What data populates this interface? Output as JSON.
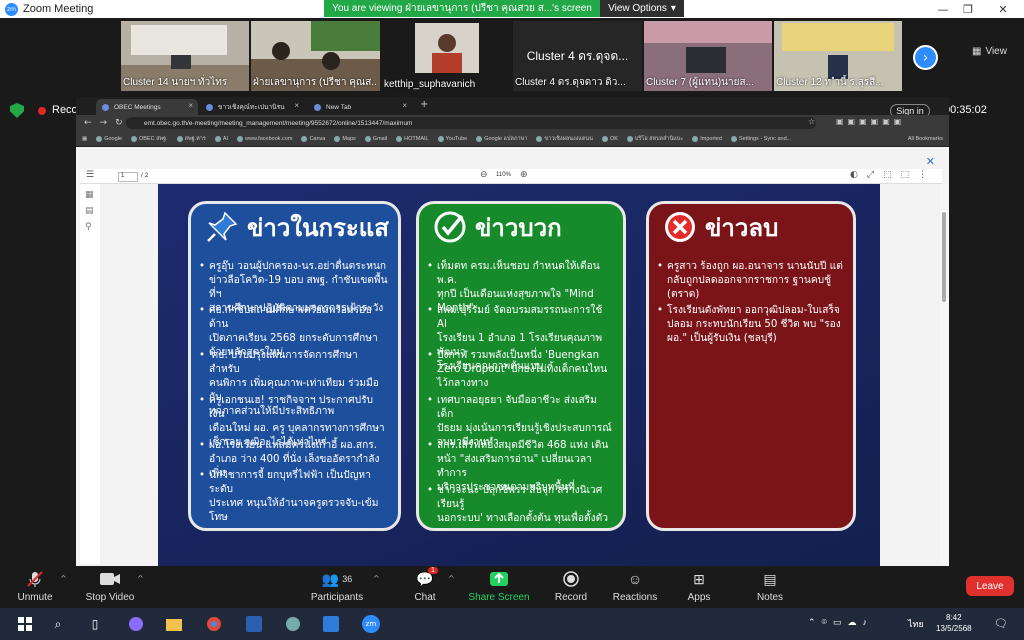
{
  "window": {
    "app_title": "Zoom Meeting",
    "viewing_banner": "You are viewing ฝ่ายเลขานุการ (ปรีชา  คุณสวย ส...'s screen",
    "view_options": "View Options"
  },
  "thumbnails": [
    {
      "caption": "Cluster 14 นายฯ ทั่วไทร",
      "kind": "room"
    },
    {
      "caption": "ฝ่ายเลขานุการ (ปรีชา  คุณส...",
      "kind": "room"
    },
    {
      "caption": "ketthip_suphavanich",
      "kind": "person"
    },
    {
      "caption": "Cluster 4 ดร.ดุจดาว ดิว...",
      "big": "Cluster 4 ดร.ดุจด...",
      "kind": "text"
    },
    {
      "caption": "Cluster 7 (ผู้แทน)นายส...",
      "kind": "room"
    },
    {
      "caption": "Cluster 12 ท ำนี้ ร.สุรสี...",
      "kind": "room"
    }
  ],
  "view_label": "View",
  "recording_label": "Recording",
  "timer": "00:35:02",
  "browser": {
    "tabs": [
      {
        "title": "OBEC Meetings"
      },
      {
        "title": "ขาวเชิงคุณ์ทะเปนานิรน"
      },
      {
        "title": "New Tab"
      }
    ],
    "url": "emt.obec.go.th/e-meeting/meeting_management/meeting/9552672/online/1513447/maximum",
    "bookmarks": [
      "Google",
      "OBEC สพฐ.",
      "สพฐ.หาร",
      "AI",
      "www.facebook.com",
      "Canva",
      "Maps",
      "Gmail",
      "HOTMAIL",
      "YouTube",
      "Google แปลภาษา",
      "ขาวเชิงผลนงงแดนน",
      "OK",
      "บริโอ สหบลลำนิแบะ",
      "Imported",
      "Settings - Sync and..."
    ],
    "all_bookmarks": "All Bookmarks",
    "sign_in": "Sign in"
  },
  "pdf": {
    "page_current": "1",
    "page_total": "/ 2",
    "zoom": "110%"
  },
  "slide": {
    "cards": [
      {
        "title": "ข่าวในกระแส",
        "icon": "pin-icon",
        "color": "#1e4f9d",
        "items": [
          "ครูอุ๊บ วอนผู้ปกครอง-นร.อย่าตื่นตระหนก\nข่าวลือโควิด-19 บอบ สพฐ. กำชับเขตพื้นที่ฯ\nสถานศึกษาปฏิบัติตามมาตรการเฝ้าระวัง",
          "ศธ.กำชับสถานศึกษาเตรียมพร้อมรอบด้าน\nเปิดภาคเรียน 2568 ยกระดับการศึกษา\nด้วยหลักสูตรใหม่",
          "'ศธ.'ปรับปรุงแผนการจัดการศึกษาสำหรับ\nคนพิการ เพิ่มคุณภาพ-เท่าเทียม ร่วมมือกับ\nทุกภาคส่วนให้มีประสิทธิภาพ",
          "ครูเอกชนเฮ! ราชกิจจาฯ ประกาศปรับเงิน\nเดือนใหม่ ผอ. ครู บุคลากรทางการศึกษา\nเช็กเลย วุฒิอะไรได้เท่าไหร่",
          "ผอ.โรงเรียน แห่สมัครนั่งเก้าอี้ ผอ.สกร.\nอำเภอ ว่าง 400 ที่นั่ง เล็งขออัตรากำลังเพิ่ม",
          "นักวิชาการจี้ ยกบุหรี่ไฟฟ้า เป็นปัญหาระดับ\nประเทศ หนุนให้อำนาจครูตรวจจับ-เข้มโทษ\nทาง กม."
        ]
      },
      {
        "title": "ข่าวบวก",
        "icon": "check-icon",
        "color": "#178a2c",
        "items": [
          "เท็มตท ครม.เห็นชอบ กำหนดให้เดือน พ.ค.\nทุกปี เป็นเดือนแห่งสุขภาพใจ \"Mind\nMonth\"",
          "สพม.บุรีรัมย์ จัดอบรมสมรรถนะการใช้ AI\nโรงเรียน 1 อำเภอ 1 โรงเรียนคุณภาพ พัฒนา\nโรงเรียนคุณภาพต้นแบบ",
          "บึงกาฬ รวมพลังเป็นหนึ่ง 'Buengkan\nZero Dropout' ปักธงไม่ทิ้งเด็กคนไหน\nไว้กลางทาง",
          "เทศบาลอยุธยา จับมืออาชีวะ ส่งเสริมเด็ก\nปัธยม มุ่งเน้นการเรียนรู้เชิงประสบการณ์\nจบมามีงานทำ",
          "สกร.เสิร์ฟห้องสมุดมีชีวิต 468 แห่ง เดิน\nหน้า \"ส่งเสริมการอ่าน\" เปลี่ยนเวลาทำการ\nบริการประชาชนตามบริบทพื้นที่",
          "ชาวจะนะ ปลุกชีพรร สืบจุก สร้างนิเวศเรียนรู้\nนอกระบบ' ทางเลือกตั้งต้น ทุนเพื่อตั้งตัว"
        ]
      },
      {
        "title": "ข่าวลบ",
        "icon": "x-icon",
        "color": "#7a1418",
        "items": [
          "ครูสาว ร้องถูก ผอ.อนาจาร นานนับปี แต่\nกลับถูกปลดออกจากราชการ ฐานคบชู้\n(ตราด)",
          "โรงเรียนดังพัทยา ออกวุฒิปลอม-ใบเสร็จ\nปลอม กระทบนักเรียน 50 ชีวิต พบ \"รอง\nผอ.\" เป็นผู้รับเงิน (ชลบุรี)"
        ]
      }
    ]
  },
  "controls": {
    "unmute": "Unmute",
    "stop_video": "Stop Video",
    "participants": "Participants",
    "participants_count": "36",
    "chat": "Chat",
    "chat_badge": "1",
    "share_screen": "Share Screen",
    "record": "Record",
    "reactions": "Reactions",
    "apps": "Apps",
    "notes": "Notes",
    "leave": "Leave"
  },
  "taskbar": {
    "lang": "ไทย",
    "time": "8:42",
    "date": "13/5/2568"
  },
  "colors": {
    "zoom_blue": "#2d8cff",
    "banner_green": "#23a847",
    "leave_red": "#e0312f",
    "share_green": "#23d160"
  }
}
